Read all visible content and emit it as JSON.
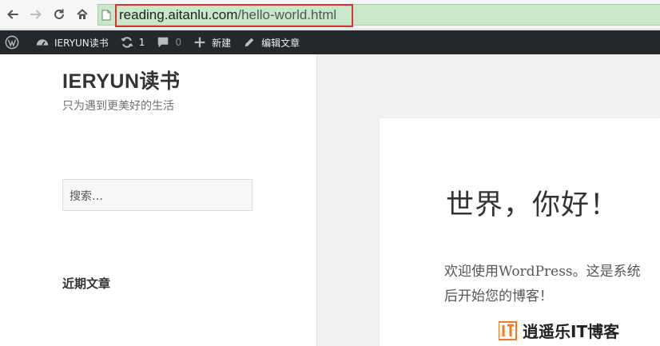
{
  "browser": {
    "url_host": "reading.aitanlu.com",
    "url_path": "/hello-world.html"
  },
  "adminbar": {
    "site_name": "IERYUN读书",
    "updates_count": "1",
    "comments_count": "0",
    "new_label": "新建",
    "edit_label": "编辑文章"
  },
  "sidebar": {
    "site_title": "IERYUN读书",
    "site_description": "只为遇到更美好的生活",
    "search_placeholder": "搜索…",
    "recent_posts_title": "近期文章"
  },
  "post": {
    "title": "世界，你好！",
    "line1": "欢迎使用WordPress。这是系统",
    "line2": "后开始您的博客！"
  },
  "watermark": {
    "text": "逍遥乐IT博客"
  },
  "colors": {
    "omnibox_bg": "#c9e8c9",
    "highlight_border": "#e03131",
    "adminbar_bg": "#23282d",
    "watermark_orange": "#f47a20"
  }
}
